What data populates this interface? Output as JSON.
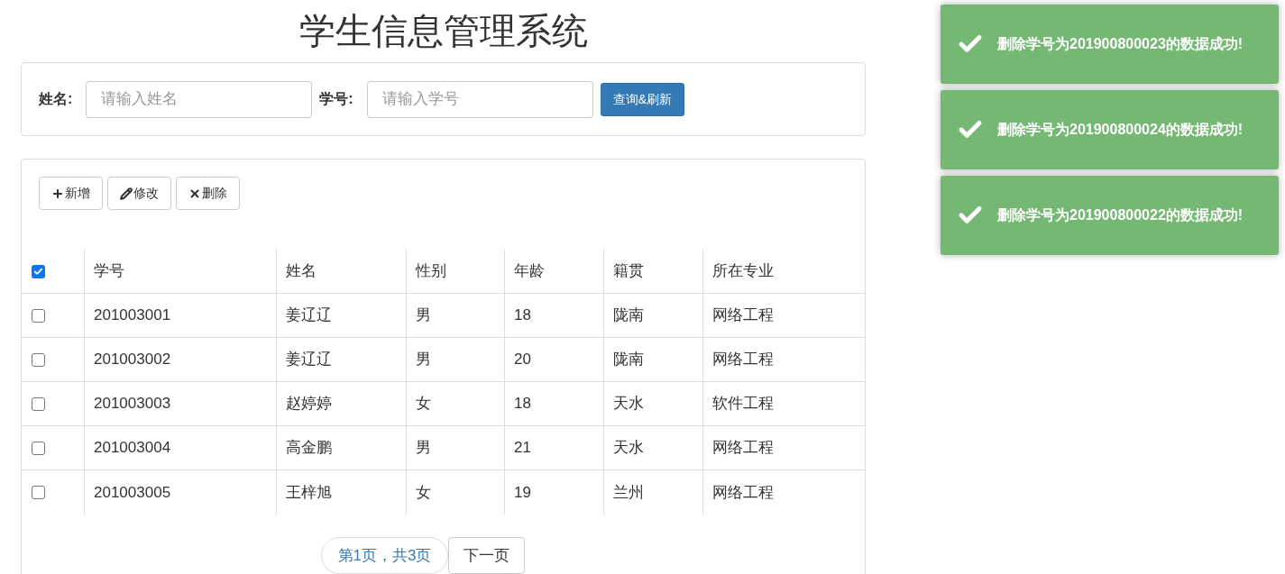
{
  "title": "学生信息管理系统",
  "search": {
    "fields": [
      {
        "label": "姓名:",
        "placeholder": "请输入姓名"
      },
      {
        "label": "学号:",
        "placeholder": "请输入学号"
      }
    ],
    "button": "查询&刷新"
  },
  "toolbar": [
    {
      "kind": "add",
      "label": "新增"
    },
    {
      "kind": "edit",
      "label": "修改"
    },
    {
      "kind": "delete",
      "label": "删除"
    }
  ],
  "table": {
    "select_all": {
      "checked": true
    },
    "columns": [
      "学号",
      "姓名",
      "性别",
      "年龄",
      "籍贯",
      "所在专业"
    ],
    "rows": [
      {
        "checked": false,
        "cells": [
          "201003001",
          "姜辽辽",
          "男",
          "18",
          "陇南",
          "网络工程"
        ]
      },
      {
        "checked": false,
        "cells": [
          "201003002",
          "姜辽辽",
          "男",
          "20",
          "陇南",
          "网络工程"
        ]
      },
      {
        "checked": false,
        "cells": [
          "201003003",
          "赵婷婷",
          "女",
          "18",
          "天水",
          "软件工程"
        ]
      },
      {
        "checked": false,
        "cells": [
          "201003004",
          "高金鹏",
          "男",
          "21",
          "天水",
          "网络工程"
        ]
      },
      {
        "checked": false,
        "cells": [
          "201003005",
          "王梓旭",
          "女",
          "19",
          "兰州",
          "网络工程"
        ]
      }
    ]
  },
  "pagination": {
    "info": "第1页，共3页",
    "next": "下一页"
  },
  "toasts": [
    {
      "message": "删除学号为201900800023的数据成功!"
    },
    {
      "message": "删除学号为201900800024的数据成功!"
    },
    {
      "message": "删除学号为201900800022的数据成功!"
    }
  ]
}
